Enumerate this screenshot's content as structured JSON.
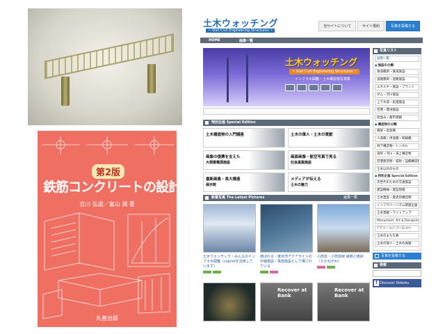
{
  "colors": {
    "book_background": "#ef6f62",
    "site_brand_blue": "#2a6fb0",
    "hero_title_yellow": "#f7c740",
    "section_header_gray": "#5b6877"
  },
  "bridge_model": {
    "icon": "bridge-model-photo"
  },
  "book": {
    "edition_badge": "第2版",
    "title": "鉄筋コンクリートの設計",
    "authors": "吉川 弘道／富山 潤 著",
    "publisher": "丸善出版"
  },
  "site": {
    "logo": "土木ウォッチング",
    "logo_subtitle": "~ Visit Civil Engineering Structures ~",
    "nav": {
      "about": "当サイトについて",
      "terms": "サイト規約",
      "submit": "写真を投稿する"
    },
    "menu": {
      "home": "HOME",
      "photos": "画像一覧"
    },
    "hero": {
      "title": "土木ウォッチング",
      "subtitle": "~ Visit Civil Engineering Structures ~",
      "caption": "インフラ大図鑑・土木構造物写真集"
    },
    "special": {
      "header": "特別企画 Special Edition",
      "cards": [
        {
          "title": "土木構造物の入門講座",
          "sub": ""
        },
        {
          "title": "土木の偉人・土木の貢献",
          "sub": ""
        },
        {
          "title": "画像の復興を支えた",
          "sub": "大規模電源施設"
        },
        {
          "title": "画面画像・航空写真で見る",
          "sub": "社会基盤施設"
        },
        {
          "title": "最新画像・長大構造",
          "sub": "展示館"
        },
        {
          "title": "メディアが伝える",
          "sub": "土木の魅力"
        }
      ]
    },
    "pictures": {
      "header": "新着写真 The Latest Pictures",
      "all_link": "画像一覧",
      "items": [
        {
          "caption": "土木ウォッチング・みんなのインフラ大図鑑（copilotを活用しています）"
        },
        {
          "caption": "雨ばれる・東京湾アクアラインの中継施設・風塔施設として構されている"
        },
        {
          "caption": "小田急・小田急線 鉄橋と橋梁（たかわがわ）"
        }
      ],
      "row2_overlay": "Recover at Bank"
    },
    "sidebar": {
      "photo_list_header": "写真リスト",
      "first_item": "画像一覧",
      "group_facilities": "施設の分類",
      "items_a": [
        "鉄道橋梁・鉄道施設",
        "道路橋梁・道路施設",
        "エネルギー施設・プラント",
        "ダム・河川施設",
        "上下水道・処理施設",
        "空港・港湾施設",
        "街並み・都市景観"
      ],
      "group_structures": "構造物の分類",
      "items_b": [
        "橋梁・高架橋",
        "人道橋・歩道橋・跨線橋",
        "地下構造物・トンネル",
        "海岸・河川・海上構造物",
        "空港建造物・堤防・設備構造物",
        "土木以外のもの"
      ],
      "group_special": "特別企画 Special Edition",
      "items_c": [
        "次世代のための交通施設",
        "建設機械・建設現場",
        "土木遺産・歴史的構造物",
        "インフラツーリズム関連企画",
        "土木景観・ライトアップ",
        "Monument, Art & Designing",
        "ﾃﾞｻﾞｲﾝ・ｴﾝｼﾞﾆｱ・ﾓﾆｭﾒﾝﾄ",
        "土木のまち写真",
        "土木の偉人・土木の貢献"
      ],
      "submit_cta": "写真を投稿する",
      "search_header": "検索",
      "facebook": "Discover Doboku"
    }
  }
}
